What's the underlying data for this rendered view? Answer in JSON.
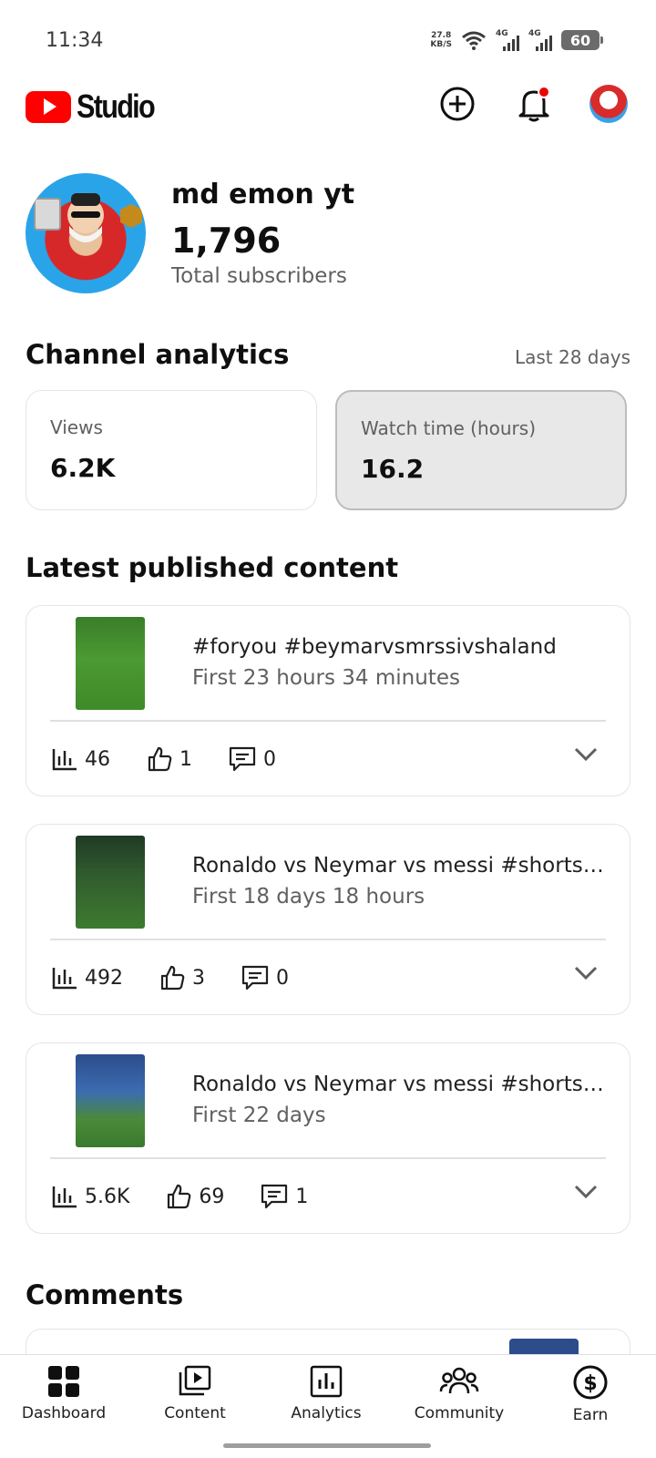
{
  "status_bar": {
    "time": "11:34",
    "net_speed_value": "27.8",
    "net_speed_unit": "KB/S",
    "signal1_label": "4G",
    "signal2_label": "4G",
    "battery": "60"
  },
  "app_bar": {
    "logo_text": "Studio"
  },
  "channel": {
    "name": "md emon yt",
    "subscribers": "1,796",
    "subscribers_label": "Total subscribers"
  },
  "analytics": {
    "title": "Channel analytics",
    "period": "Last 28 days",
    "metrics": [
      {
        "label": "Views",
        "value": "6.2K",
        "selected": false
      },
      {
        "label": "Watch time (hours)",
        "value": "16.2",
        "selected": true
      }
    ]
  },
  "latest": {
    "title": "Latest published content",
    "items": [
      {
        "title": "#foryou #beymarvsmrssivshaland",
        "subtitle": "First 23 hours 34 minutes",
        "views": "46",
        "likes": "1",
        "comments": "0"
      },
      {
        "title": "Ronaldo vs Neymar vs messi #shorts #shorts",
        "subtitle": "First 18 days 18 hours",
        "views": "492",
        "likes": "3",
        "comments": "0"
      },
      {
        "title": "Ronaldo vs Neymar vs messi #shorts #shorts",
        "subtitle": "First 22 days",
        "views": "5.6K",
        "likes": "69",
        "comments": "1"
      }
    ]
  },
  "comments": {
    "title": "Comments"
  },
  "bottom_nav": {
    "items": [
      {
        "label": "Dashboard",
        "icon": "dashboard-icon"
      },
      {
        "label": "Content",
        "icon": "content-icon"
      },
      {
        "label": "Analytics",
        "icon": "analytics-icon"
      },
      {
        "label": "Community",
        "icon": "community-icon"
      },
      {
        "label": "Earn",
        "icon": "earn-icon"
      }
    ]
  },
  "colors": {
    "brand_red": "#ff0000",
    "text_primary": "#0f0f0f",
    "text_secondary": "#606060",
    "selected_card_bg": "#e8e8e8"
  }
}
